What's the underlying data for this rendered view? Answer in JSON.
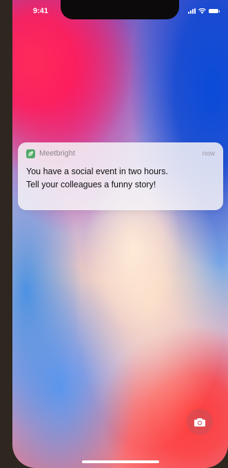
{
  "status_bar": {
    "time": "9:41",
    "signal_icon": "cellular-signal-icon",
    "wifi_icon": "wifi-icon",
    "battery_icon": "battery-icon"
  },
  "notification": {
    "app_icon": "leaf-icon",
    "app_name": "Meetbright",
    "time": "now",
    "line1": "You have a social event in two hours.",
    "line2": "Tell your colleagues a funny story!"
  },
  "lock_screen": {
    "camera_icon": "camera-icon"
  },
  "colors": {
    "notification_bg": "#f5f2f6",
    "app_icon_green": "#52a86a",
    "bezel": "#2e2720"
  }
}
